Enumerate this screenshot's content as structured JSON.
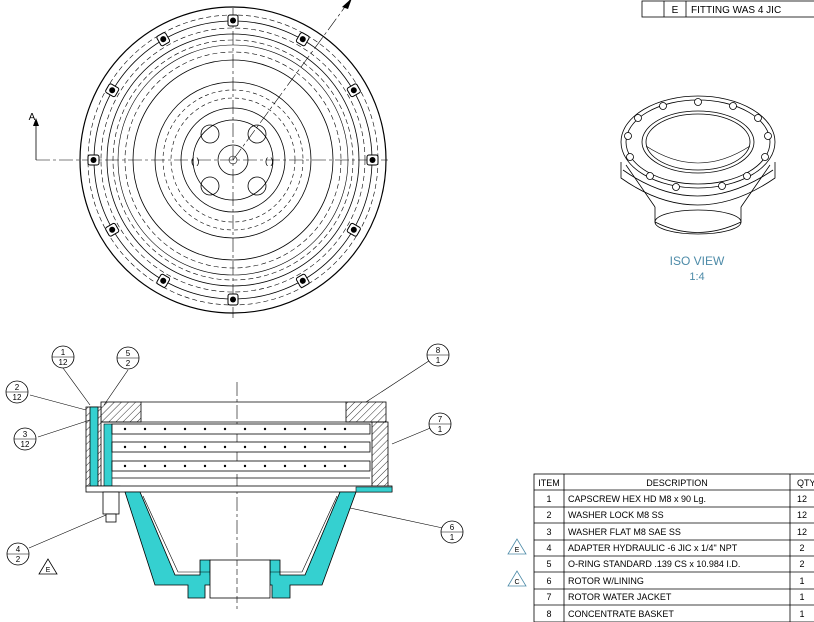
{
  "revision_note": {
    "rev": "E",
    "text": "FITTING WAS 4 JIC"
  },
  "section_marker": "A",
  "iso_view": {
    "title": "ISO VIEW",
    "scale": "1:4"
  },
  "balloons": [
    {
      "item": "1",
      "qty": "12"
    },
    {
      "item": "5",
      "qty": "2"
    },
    {
      "item": "2",
      "qty": "12"
    },
    {
      "item": "3",
      "qty": "12"
    },
    {
      "item": "8",
      "qty": "1"
    },
    {
      "item": "7",
      "qty": "1"
    },
    {
      "item": "6",
      "qty": "1"
    },
    {
      "item": "4",
      "qty": "2"
    }
  ],
  "rev_flag_balloon": "E",
  "bom": {
    "headers": [
      "ITEM",
      "DESCRIPTION",
      "QTY"
    ],
    "rows": [
      {
        "rev": "",
        "item": "1",
        "description": "CAPSCREW HEX HD M8 x 90 Lg.",
        "qty": "12"
      },
      {
        "rev": "",
        "item": "2",
        "description": "WASHER LOCK M8 SS",
        "qty": "12"
      },
      {
        "rev": "",
        "item": "3",
        "description": "WASHER FLAT M8 SAE SS",
        "qty": "12"
      },
      {
        "rev": "E",
        "item": "4",
        "description": "ADAPTER HYDRAULIC -6 JIC x 1/4\" NPT",
        "qty": "2"
      },
      {
        "rev": "",
        "item": "5",
        "description": "O-RING STANDARD .139 CS x 10.984 I.D.",
        "qty": "2"
      },
      {
        "rev": "C",
        "item": "6",
        "description": "ROTOR W/LINING",
        "qty": "1"
      },
      {
        "rev": "",
        "item": "7",
        "description": "ROTOR WATER JACKET",
        "qty": "1"
      },
      {
        "rev": "",
        "item": "8",
        "description": "CONCENTRATE BASKET",
        "qty": "1"
      }
    ]
  },
  "colors": {
    "section_fill": "#35d0d0",
    "iso_line": "#4d8ba8",
    "line": "#000000"
  }
}
